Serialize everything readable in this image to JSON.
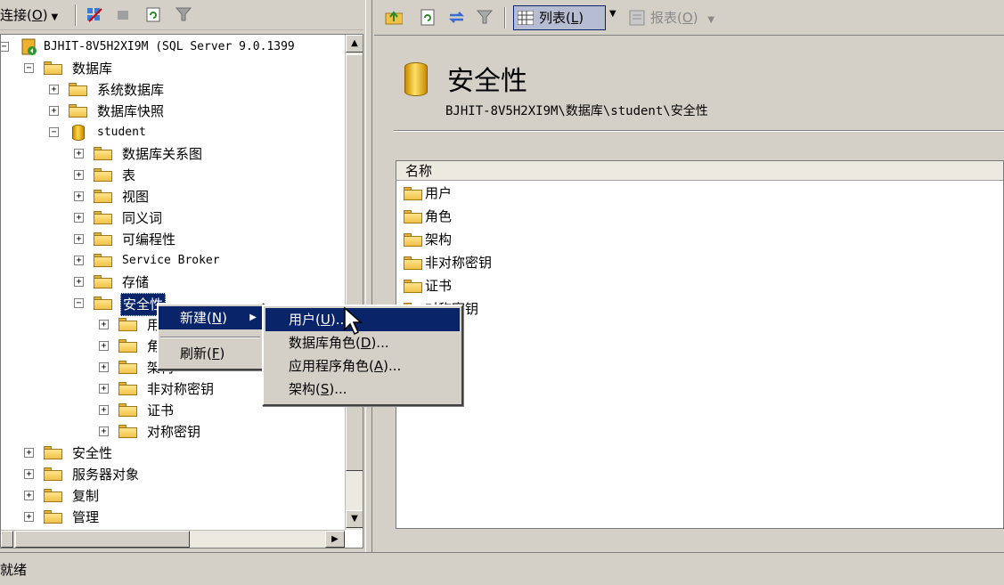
{
  "explorer": {
    "toolbar": {
      "connect_label": "连接",
      "connect_accel": "O",
      "icons": [
        "connect-dropdown-icon",
        "register-server-icon",
        "stop-icon",
        "refresh-icon",
        "filter-icon"
      ]
    },
    "server_node": "BJHIT-8V5H2XI9M (SQL Server 9.0.1399",
    "databases": "数据库",
    "system_dbs": "系统数据库",
    "db_snapshots": "数据库快照",
    "student": "student",
    "student_children": [
      "数据库关系图",
      "表",
      "视图",
      "同义词",
      "可编程性",
      "Service Broker",
      "存储"
    ],
    "security_selected": "安全性",
    "security_children": [
      "用户",
      "角色",
      "架构",
      "非对称密钥",
      "证书",
      "对称密钥"
    ],
    "server_children": [
      "安全性",
      "服务器对象",
      "复制",
      "管理"
    ]
  },
  "summary": {
    "toolbar": {
      "view_label": "列表",
      "view_accel": "L",
      "report_label": "报表",
      "report_accel": "O"
    },
    "title": "安全性",
    "path": "BJHIT-8V5H2XI9M\\数据库\\student\\安全性",
    "column_name": "名称",
    "items": [
      "用户",
      "角色",
      "架构",
      "非对称密钥",
      "证书",
      "对称密钥"
    ]
  },
  "context_menu": {
    "new": {
      "label": "新建",
      "accel": "N"
    },
    "refresh": {
      "label": "刷新",
      "accel": "F"
    }
  },
  "submenu": {
    "user": {
      "label": "用户",
      "accel": "U",
      "suffix": "..."
    },
    "db_role": {
      "label": "数据库角色",
      "accel": "D",
      "suffix": "..."
    },
    "app_role": {
      "label": "应用程序角色",
      "accel": "A",
      "suffix": "..."
    },
    "schema": {
      "label": "架构",
      "accel": "S",
      "suffix": "..."
    }
  },
  "status": {
    "text": "就绪"
  },
  "colors": {
    "selection": "#0a246a",
    "chrome": "#d4d0c8",
    "folder": "#f1c24a"
  }
}
